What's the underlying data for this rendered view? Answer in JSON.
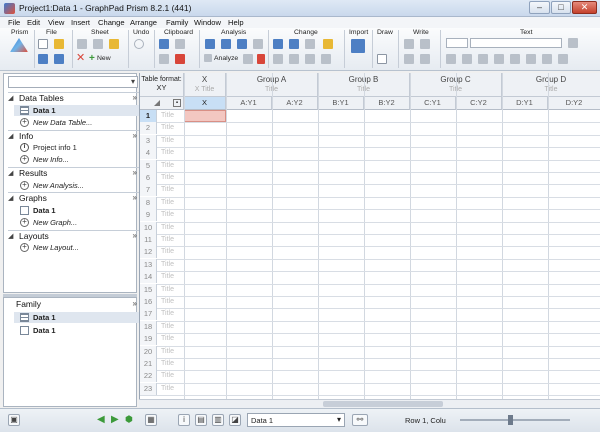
{
  "window": {
    "title": "Project1:Data 1 - GraphPad Prism 8.2.1 (441)"
  },
  "menu": [
    "File",
    "Edit",
    "View",
    "Insert",
    "Change",
    "Arrange",
    "Family",
    "Window",
    "Help"
  ],
  "ribbon": {
    "groups": [
      "Prism",
      "File",
      "Sheet",
      "Undo",
      "Clipboard",
      "Analysis",
      "Change",
      "Import",
      "Draw",
      "Write",
      "Text"
    ],
    "new_label": "New",
    "analyze_label": "Analyze"
  },
  "navigator": {
    "sections": [
      {
        "title": "Data Tables",
        "items": [
          {
            "label": "Data 1",
            "style": "bold",
            "icon": "sheet"
          },
          {
            "label": "New Data Table...",
            "style": "italic",
            "icon": "plus"
          }
        ]
      },
      {
        "title": "Info",
        "items": [
          {
            "label": "Project info 1",
            "style": "normal",
            "icon": "info"
          },
          {
            "label": "New Info...",
            "style": "italic",
            "icon": "plus"
          }
        ]
      },
      {
        "title": "Results",
        "items": [
          {
            "label": "New Analysis...",
            "style": "italic",
            "icon": "plus"
          }
        ]
      },
      {
        "title": "Graphs",
        "items": [
          {
            "label": "Data 1",
            "style": "bold",
            "icon": "graph"
          },
          {
            "label": "New Graph...",
            "style": "italic",
            "icon": "plus"
          }
        ]
      },
      {
        "title": "Layouts",
        "items": [
          {
            "label": "New Layout...",
            "style": "italic",
            "icon": "plus"
          }
        ]
      }
    ]
  },
  "family": {
    "title": "Family",
    "items": [
      {
        "label": "Data 1",
        "icon": "sheet"
      },
      {
        "label": "Data 1",
        "icon": "graph"
      }
    ]
  },
  "sheet": {
    "table_format_label": "Table format:",
    "table_format_value": "XY",
    "x_col": {
      "name": "X",
      "title": "X Title",
      "sub": "X"
    },
    "groups": [
      {
        "name": "Group A",
        "title": "Title",
        "subs": [
          "A:Y1",
          "A:Y2"
        ]
      },
      {
        "name": "Group B",
        "title": "Title",
        "subs": [
          "B:Y1",
          "B:Y2"
        ]
      },
      {
        "name": "Group C",
        "title": "Title",
        "subs": [
          "C:Y1",
          "C:Y2"
        ]
      },
      {
        "name": "Group D",
        "title": "Title",
        "subs": [
          "D:Y1",
          "D:Y2"
        ]
      }
    ],
    "row_title": "Title",
    "rows": 23
  },
  "statusbar": {
    "sheet_select": "Data 1",
    "status": "Row 1, Colu"
  }
}
